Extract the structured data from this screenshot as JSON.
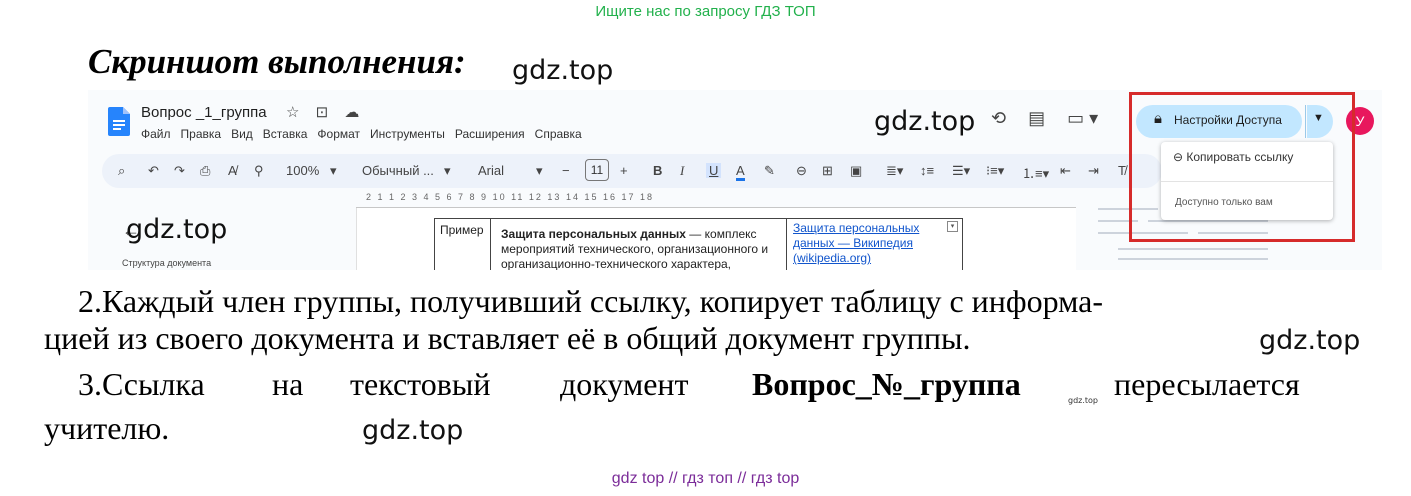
{
  "promo": "Ищите нас по запросу ГДЗ ТОП",
  "heading": "Скриншот выполнения:",
  "watermark": "gdz.top",
  "screenshot": {
    "doc_title": "Вопрос _1_группа",
    "title_icons": "☆ ⊡ ☁",
    "menu": [
      "Файл",
      "Правка",
      "Вид",
      "Вставка",
      "Формат",
      "Инструменты",
      "Расширения",
      "Справка"
    ],
    "header_icons": [
      "⟲",
      "▤",
      "▭ ▾"
    ],
    "share_button": "Настройки Доступа",
    "avatar_letter": "У",
    "toolbar": {
      "zoom": "100%",
      "style": "Обычный ...",
      "font": "Arial",
      "font_size": "11",
      "bold": "B",
      "italic": "I",
      "underline": "U",
      "text_color": "A"
    },
    "ruler_numbers": "2  1  1  2  3  4  5  6  7  8  9  10  11  12  13  14  15  16  17  18",
    "outline_label": "Структура документа",
    "table": {
      "label": "Пример",
      "term": "Защита персональных данных",
      "definition_line1": " — комплекс",
      "definition_line2": "мероприятий технического, организационного и",
      "definition_line3": "организационно-технического характера,",
      "link_line1": "Защита персональных",
      "link_line2": "данных — Википедия",
      "link_line3": "(wikipedia.org)"
    },
    "popup": {
      "copy_link": "Копировать ссылку",
      "access_note": "Доступно только вам"
    }
  },
  "paragraph2": {
    "line1": "2.Каждый член группы, получивший ссылку, копирует таблицу с информа-",
    "line2": "цией из своего документа и вставляет её в общий документ группы."
  },
  "paragraph3": {
    "line1_a": "3.Ссылка",
    "line1_b": "на",
    "line1_c": "текстовый",
    "line1_d": "документ",
    "line1_bold": "Вопрос_№_группа",
    "line1_small_wm": "gdz.top",
    "line1_e": "пересылается",
    "line2": "учителю."
  },
  "footer": "gdz top  //  гдз топ  //  гдз top"
}
